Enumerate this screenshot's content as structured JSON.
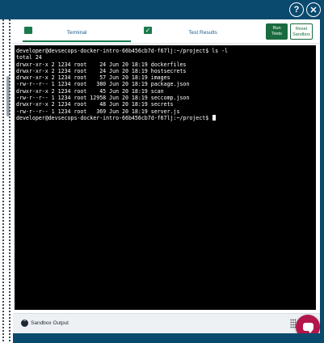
{
  "header": {
    "help_icon_glyph": "?",
    "close_icon_glyph": "✕"
  },
  "tabs": {
    "terminal_label": "Terminal",
    "results_label": "Test Results"
  },
  "buttons": {
    "run_tests_label": "Run\nTests",
    "reset_sandbox_label": "Reset\nSandbox"
  },
  "terminal": {
    "lines": [
      "developer@devsecops-docker-intro-66b456cb7d-f67lj:~/project$ ls -l",
      "total 24",
      "drwxr-xr-x 2 1234 root    24 Jun 20 18:19 dockerfiles",
      "drwxr-xr-x 2 1234 root    24 Jun 20 18:19 hostsecrets",
      "drwxr-xr-x 2 1234 root    57 Jun 20 18:19 images",
      "-rw-r--r-- 1 1234 root   380 Jun 20 18:19 package.json",
      "drwxr-xr-x 2 1234 root    45 Jun 20 18:19 scan",
      "-rw-r--r-- 1 1234 root 12958 Jun 20 18:19 seccomp.json",
      "drwxr-xr-x 2 1234 root    48 Jun 20 18:19 secrets",
      "-rw-r--r-- 1 1234 root   369 Jun 20 18:19 server.js",
      "developer@devsecops-docker-intro-66b456cb7d-f67lj:~/project$ "
    ]
  },
  "footer": {
    "sandbox_output_label": "Sandbox Output"
  },
  "colors": {
    "accent": "#1a6b3f",
    "chat": "#b3164a",
    "header_bg": "#0b4a6f"
  }
}
